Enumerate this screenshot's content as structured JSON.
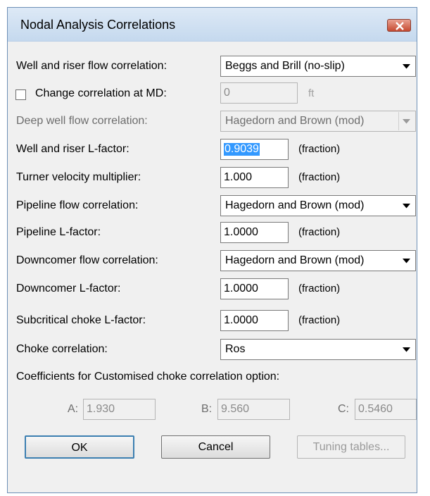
{
  "window": {
    "title": "Nodal Analysis Correlations"
  },
  "labels": {
    "well_riser_flow": "Well and riser flow correlation:",
    "change_at_md": "Change correlation at MD:",
    "deep_well_flow": "Deep well flow correlation:",
    "well_riser_lfactor": "Well and riser L-factor:",
    "turner_multiplier": "Turner velocity multiplier:",
    "pipeline_flow": "Pipeline flow correlation:",
    "pipeline_lfactor": "Pipeline L-factor:",
    "downcomer_flow": "Downcomer flow correlation:",
    "downcomer_lfactor": "Downcomer L-factor:",
    "subcritical_choke_lfactor": "Subcritical choke L-factor:",
    "choke_correlation": "Choke correlation:",
    "coefficients": "Coefficients for Customised choke correlation option:",
    "coef_a": "A:",
    "coef_b": "B:",
    "coef_c": "C:"
  },
  "values": {
    "well_riser_flow": "Beggs and Brill (no-slip)",
    "change_at_md": "0",
    "deep_well_flow": "Hagedorn and Brown (mod)",
    "well_riser_lfactor": "0.9039",
    "turner_multiplier": "1.000",
    "pipeline_flow": "Hagedorn and Brown (mod)",
    "pipeline_lfactor": "1.0000",
    "downcomer_flow": "Hagedorn and Brown (mod)",
    "downcomer_lfactor": "1.0000",
    "subcritical_choke_lfactor": "1.0000",
    "choke_correlation": "Ros",
    "coef_a": "1.930",
    "coef_b": "9.560",
    "coef_c": "0.5460"
  },
  "units": {
    "ft": "ft",
    "fraction": "(fraction)"
  },
  "checkbox": {
    "change_at_md_checked": false
  },
  "buttons": {
    "ok": "OK",
    "cancel": "Cancel",
    "tuning": "Tuning tables..."
  },
  "icons": {
    "close": "close-icon",
    "dropdown": "chevron-down-icon"
  },
  "colors": {
    "title_bar": "#c5d9ee",
    "close_button": "#c64b32",
    "selection": "#3399ff"
  }
}
